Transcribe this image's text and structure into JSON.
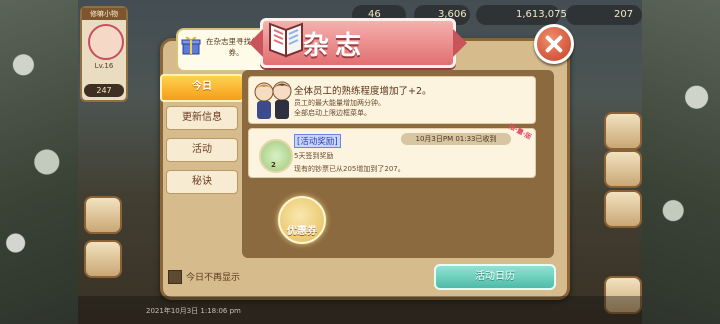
{
  "hud": {
    "profile_name": "修嘛小物",
    "level": "Lv.16",
    "count": "247",
    "hearts": "46",
    "coins": "3,606",
    "cash": "1,613,075",
    "gems": "207",
    "right_number": "3"
  },
  "hint": {
    "text": "在杂志里寻找兑换券。"
  },
  "dialog": {
    "title": "杂志"
  },
  "tabs": [
    {
      "label": "今日",
      "active": true
    },
    {
      "label": "更新信息",
      "active": false
    },
    {
      "label": "活动",
      "active": false
    },
    {
      "label": "秘诀",
      "active": false
    }
  ],
  "news": {
    "title": "全体员工的熟练程度增加了+2。",
    "line1": "员工的最大能量增加两分钟。",
    "line2": "全部启动上限边框菜单。"
  },
  "event": {
    "tag": "[活动奖励]",
    "time": "10月3日PM 01:33已收到",
    "stamp": "限·量·版",
    "line1": "5天签到奖励",
    "line2": "现有的钞票已从205增加到了207。",
    "qty": "2"
  },
  "coupon": {
    "label": "优惠券"
  },
  "bottom": {
    "checkbox_label": "今日不再显示",
    "calendar_button": "活动日历",
    "timestamp": "2021年10月3日 1:18:06 pm"
  },
  "colors": {
    "accent": "#f59e1a",
    "ribbon": "#e26f72",
    "button": "#4fbba7"
  }
}
